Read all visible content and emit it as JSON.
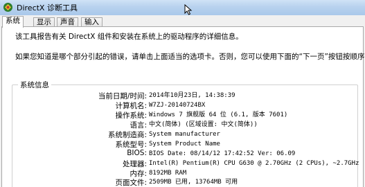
{
  "window": {
    "title": "DirectX 诊断工具"
  },
  "tabs": [
    {
      "label": "系统",
      "active": true
    },
    {
      "label": "显示",
      "active": false
    },
    {
      "label": "声音",
      "active": false
    },
    {
      "label": "输入",
      "active": false
    }
  ],
  "intro": {
    "line1": "该工具报告有关 DirectX 组件和安装在系统上的驱动程序的详细信息。",
    "line2": "如果您知道是哪个部分引起的错误，请单击上面适当的选项卡。否则，您可以使用下面的“下一页”按钮按顺序查阅每一页。"
  },
  "system_info": {
    "title": "系统信息",
    "rows": [
      {
        "label": "当前日期/时间:",
        "value": "2014年10月23日, 14:38:39"
      },
      {
        "label": "计算机名:",
        "value": "W7ZJ-20140724BX"
      },
      {
        "label": "操作系统:",
        "value": "Windows 7 旗舰版 64 位 (6.1, 版本 7601)"
      },
      {
        "label": "语言:",
        "value": "中文(简体) (区域设置: 中文(简体))"
      },
      {
        "label": "系统制造商:",
        "value": "System manufacturer"
      },
      {
        "label": "系统型号:",
        "value": "System Product Name"
      },
      {
        "label": "BIOS:",
        "value": "BIOS Date: 08/14/12 17:42:52 Ver: 06.09"
      },
      {
        "label": "处理器:",
        "value": "Intel(R) Pentium(R) CPU G630 @ 2.70GHz (2 CPUs), ~2.7GHz"
      },
      {
        "label": "内存:",
        "value": "8192MB RAM"
      },
      {
        "label": "页面文件:",
        "value": "2509MB 已用, 13764MB 可用"
      }
    ]
  },
  "icons": {
    "title_icon": "directx-icon",
    "cursor": "mouse-cursor-icon"
  }
}
